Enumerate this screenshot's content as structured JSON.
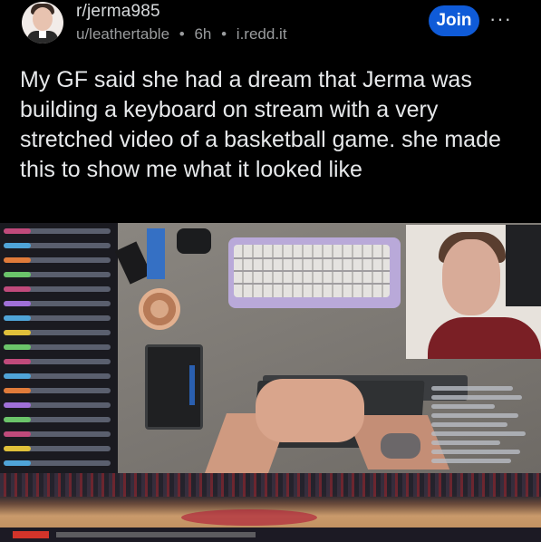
{
  "post": {
    "subreddit": "r/jerma985",
    "author": "u/leathertable",
    "separator": "•",
    "age": "6h",
    "domain": "i.redd.it",
    "join_label": "Join",
    "more_label": "···",
    "title": "My GF said she had a dream that Jerma was building a keyboard on stream with a very stretched video of a basketball game. she made this to show me what it looked like"
  },
  "colors": {
    "background": "#000000",
    "join_button": "#0f5bd8",
    "title_text": "#e6e8ea",
    "meta_text": "#9a9c9e"
  },
  "icons": {
    "avatar": "subreddit-avatar",
    "more": "ellipsis-icon"
  }
}
